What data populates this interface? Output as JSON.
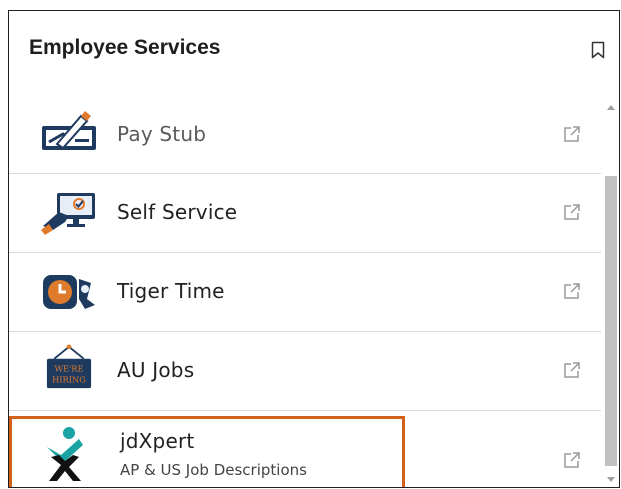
{
  "panel": {
    "title": "Employee Services",
    "bookmark_icon": "bookmark-icon"
  },
  "items": [
    {
      "label": "Pay Stub",
      "icon": "paycheck-icon",
      "external_icon": "external-link-icon"
    },
    {
      "label": "Self Service",
      "icon": "computer-touch-icon",
      "external_icon": "external-link-icon"
    },
    {
      "label": "Tiger Time",
      "icon": "clock-badge-icon",
      "external_icon": "external-link-icon"
    },
    {
      "label": "AU Jobs",
      "icon": "were-hiring-sign-icon",
      "icon_text_line1": "WE'RE",
      "icon_text_line2": "HIRING",
      "external_icon": "external-link-icon"
    },
    {
      "label": "jdXpert",
      "sublabel": "AP & US Job Descriptions",
      "icon": "jdxpert-logo-icon",
      "external_icon": "external-link-icon",
      "highlighted": true
    }
  ],
  "colors": {
    "highlight_border": "#d2621b",
    "divider": "#d9d9d9",
    "scroll_thumb": "#c1c1c1"
  }
}
